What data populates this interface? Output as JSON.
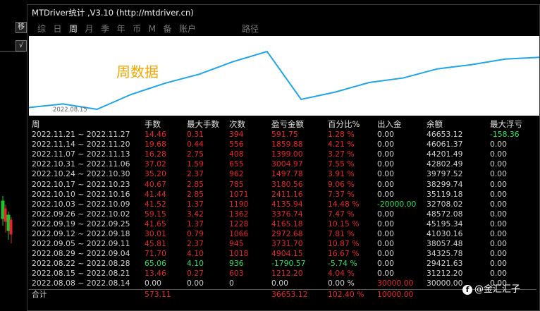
{
  "window": {
    "title": "MTDriver统计 ,V3.10 (http://mtdriver.cn)"
  },
  "side_buttons": [
    "移",
    "√"
  ],
  "tabs": [
    {
      "label": "综",
      "active": false
    },
    {
      "label": "日",
      "active": false
    },
    {
      "label": "周",
      "active": true
    },
    {
      "label": "月",
      "active": false
    },
    {
      "label": "季",
      "active": false
    },
    {
      "label": "年",
      "active": false
    },
    {
      "label": "币",
      "active": false
    },
    {
      "label": "M",
      "active": false
    },
    {
      "label": "备",
      "active": false
    },
    {
      "label": "账户",
      "active": false
    }
  ],
  "tab_right": "路径",
  "chart": {
    "label": "周数据",
    "start_date": "2022.08.15",
    "line_color": "#1ea5e8",
    "series": [
      30000.0,
      31212.2,
      29421.63,
      34325.78,
      38057.48,
      41030.16,
      45195.34,
      48572.08,
      32708.02,
      35119.18,
      38299.74,
      39797.52,
      42802.49,
      44201.49,
      46061.37,
      46653.12
    ]
  },
  "table": {
    "headers": [
      "周",
      "手数",
      "最大手数",
      "次数",
      "盈亏金额",
      "百分比%",
      "出入金",
      "余额",
      "最大浮亏"
    ],
    "rows": [
      {
        "cells": [
          "2022.11.21 ~ 2022.11.27",
          "14.46",
          "0.31",
          "394",
          "591.75",
          "1.28 %",
          "0.00",
          "46653.12",
          "-158.36"
        ],
        "tone": "red",
        "float_tone": "green"
      },
      {
        "cells": [
          "2022.11.14 ~ 2022.11.20",
          "19.68",
          "0.44",
          "556",
          "1859.88",
          "4.21 %",
          "0.00",
          "46061.37",
          "0.00"
        ],
        "tone": "red"
      },
      {
        "cells": [
          "2022.11.07 ~ 2022.11.13",
          "16.28",
          "2.75",
          "408",
          "1399.00",
          "3.27 %",
          "0.00",
          "44201.49",
          "0.00"
        ],
        "tone": "red"
      },
      {
        "cells": [
          "2022.10.31 ~ 2022.11.06",
          "37.02",
          "1.59",
          "655",
          "3004.97",
          "7.55 %",
          "0.00",
          "42802.49",
          "0.00"
        ],
        "tone": "red"
      },
      {
        "cells": [
          "2022.10.24 ~ 2022.10.30",
          "35.20",
          "2.37",
          "962",
          "1497.78",
          "3.91 %",
          "0.00",
          "39797.52",
          "0.00"
        ],
        "tone": "red"
      },
      {
        "cells": [
          "2022.10.17 ~ 2022.10.23",
          "40.67",
          "2.85",
          "785",
          "3180.56",
          "9.06 %",
          "0.00",
          "38299.74",
          "0.00"
        ],
        "tone": "red"
      },
      {
        "cells": [
          "2022.10.10 ~ 2022.10.16",
          "41.44",
          "2.85",
          "1071",
          "2411.16",
          "7.37 %",
          "0.00",
          "35119.18",
          "0.00"
        ],
        "tone": "red"
      },
      {
        "cells": [
          "2022.10.03 ~ 2022.10.09",
          "41.52",
          "1.37",
          "1190",
          "4135.94",
          "14.48 %",
          "-20000.00",
          "32708.02",
          "0.00"
        ],
        "tone": "red",
        "cash_tone": "green"
      },
      {
        "cells": [
          "2022.09.26 ~ 2022.10.02",
          "59.15",
          "3.42",
          "1362",
          "3376.74",
          "7.47 %",
          "0.00",
          "48572.08",
          "0.00"
        ],
        "tone": "red"
      },
      {
        "cells": [
          "2022.09.19 ~ 2022.09.25",
          "41.65",
          "1.37",
          "1228",
          "4165.18",
          "10.15 %",
          "0.00",
          "45195.34",
          "0.00"
        ],
        "tone": "red"
      },
      {
        "cells": [
          "2022.09.12 ~ 2022.09.18",
          "30.01",
          "0.79",
          "1066",
          "2972.68",
          "7.81 %",
          "0.00",
          "41030.16",
          "0.00"
        ],
        "tone": "red"
      },
      {
        "cells": [
          "2022.09.05 ~ 2022.09.11",
          "45.81",
          "2.37",
          "945",
          "3731.70",
          "10.87 %",
          "0.00",
          "38057.48",
          "0.00"
        ],
        "tone": "red"
      },
      {
        "cells": [
          "2022.08.29 ~ 2022.09.04",
          "71.70",
          "4.10",
          "1018",
          "4904.15",
          "16.67 %",
          "0.00",
          "34325.78",
          "0.00"
        ],
        "tone": "red"
      },
      {
        "cells": [
          "2022.08.22 ~ 2022.08.28",
          "65.06",
          "4.10",
          "936",
          "-1790.57",
          "-5.74 %",
          "0.00",
          "29421.63",
          "0.00"
        ],
        "tone": "green"
      },
      {
        "cells": [
          "2022.08.15 ~ 2022.08.21",
          "13.46",
          "0.27",
          "603",
          "1212.20",
          "4.04 %",
          "0.00",
          "31212.20",
          "0.00"
        ],
        "tone": "red"
      },
      {
        "cells": [
          "2022.08.08 ~ 2022.08.14",
          "0.00",
          "0.00",
          "0",
          "0.00",
          "0.00 %",
          "30000.00",
          "30000.00",
          "0.00"
        ],
        "tone": "white",
        "cash_tone": "red"
      }
    ],
    "total": {
      "label": "合计",
      "lots": "573.11",
      "pnl": "36653.12",
      "pct": "102.40 %",
      "cash": "10000.00"
    }
  },
  "watermark": "@金汇汇子",
  "colors": {
    "profit": "#e8222b",
    "loss": "#27e060",
    "accent": "#f2a600",
    "line": "#1ea5e8"
  }
}
